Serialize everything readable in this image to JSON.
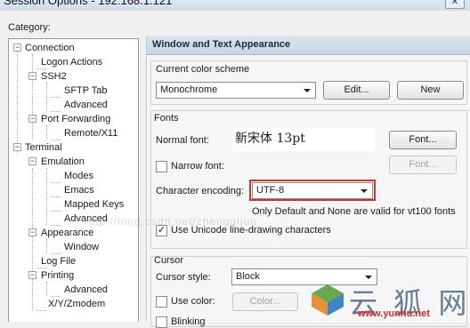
{
  "window": {
    "title": "Session Options - 192.168.1.121",
    "close_glyph": "✕"
  },
  "category_label": "Category:",
  "tree": [
    {
      "label": "Connection",
      "expander": "−"
    },
    {
      "label": "Logon Actions"
    },
    {
      "label": "SSH2",
      "expander": "−"
    },
    {
      "label": "SFTP Tab"
    },
    {
      "label": "Advanced"
    },
    {
      "label": "Port Forwarding",
      "expander": "−"
    },
    {
      "label": "Remote/X11"
    },
    {
      "label": "Terminal",
      "expander": "−"
    },
    {
      "label": "Emulation",
      "expander": "−"
    },
    {
      "label": "Modes"
    },
    {
      "label": "Emacs"
    },
    {
      "label": "Mapped Keys"
    },
    {
      "label": "Advanced"
    },
    {
      "label": "Appearance",
      "expander": "−"
    },
    {
      "label": "Window"
    },
    {
      "label": "Log File"
    },
    {
      "label": "Printing",
      "expander": "−"
    },
    {
      "label": "Advanced"
    },
    {
      "label": "X/Y/Zmodem"
    }
  ],
  "panel": {
    "header": "Window and Text Appearance",
    "color_scheme": {
      "label": "Current color scheme",
      "value": "Monochrome",
      "edit_button": "Edit...",
      "new_button": "New"
    },
    "fonts": {
      "label": "Fonts",
      "normal_font_label": "Normal font:",
      "normal_font_value": "新宋体 13pt",
      "font_button": "Font...",
      "narrow_font_label": "Narrow font:",
      "narrow_font_button": "Font...",
      "encoding_label": "Character encoding:",
      "encoding_value": "UTF-8",
      "encoding_note": "Only Default and None are valid for vt100 fonts",
      "unicode_line_label": "Use Unicode line-drawing characters",
      "unicode_checked_glyph": "✓"
    },
    "cursor": {
      "label": "Cursor",
      "style_label": "Cursor style:",
      "style_value": "Block",
      "use_color_label": "Use color:",
      "color_button": "Color...",
      "blinking_label": "Blinking"
    }
  },
  "watermark_text": "http://blog.csdn.net/zhengqijun_",
  "logo": {
    "text": "云 狐 网",
    "url": "www.yunhu.net"
  },
  "colors": {
    "highlight": "#c0392b",
    "header_bg": "#c8d4e3",
    "logo_text": "#6b7b96",
    "logo_url": "#d42a2a"
  }
}
